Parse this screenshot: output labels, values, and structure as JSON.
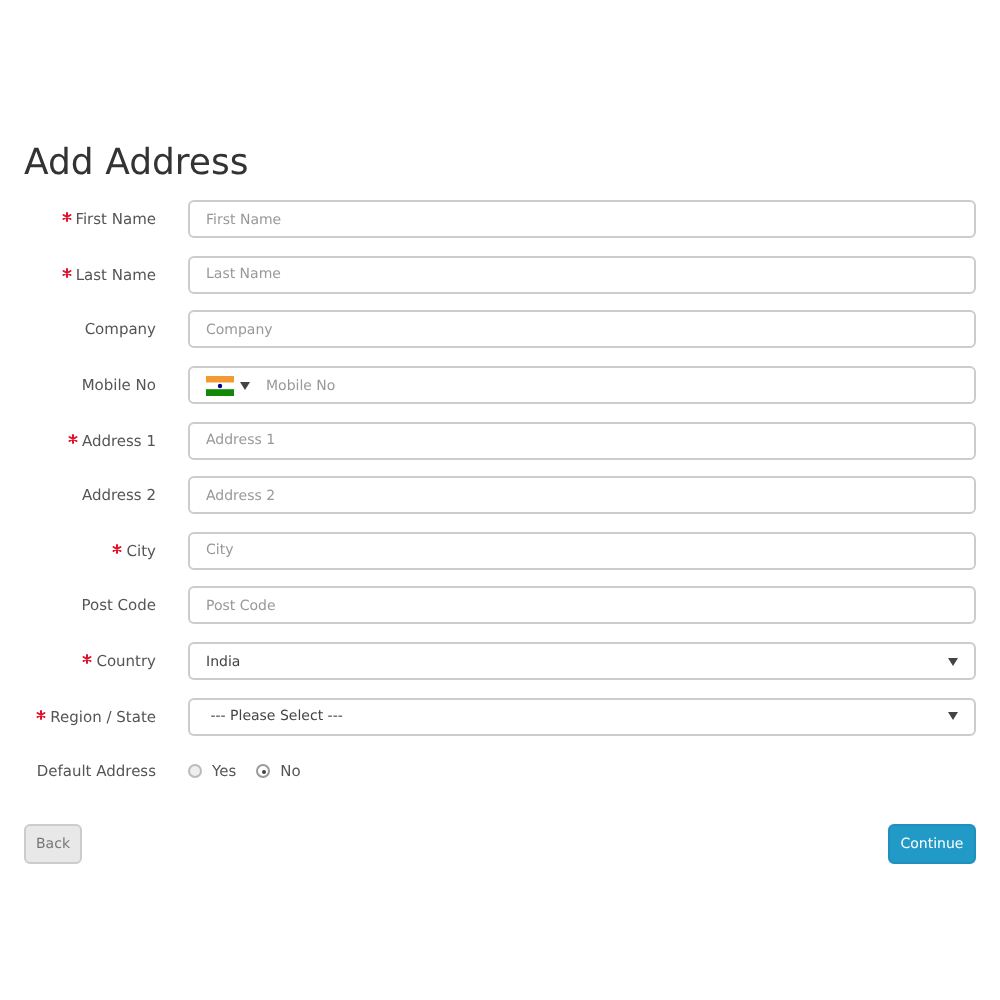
{
  "title": "Add Address",
  "fields": [
    {
      "kind": "text",
      "label": "First Name",
      "required": true,
      "placeholder": "First Name"
    },
    {
      "kind": "text",
      "label": "Last Name",
      "required": true,
      "placeholder": "Last Name"
    },
    {
      "kind": "text",
      "label": "Company",
      "required": false,
      "placeholder": "Company"
    },
    {
      "kind": "phone",
      "label": "Mobile No",
      "required": false,
      "placeholder": "Mobile No"
    },
    {
      "kind": "text",
      "label": "Address 1",
      "required": true,
      "placeholder": "Address 1"
    },
    {
      "kind": "text",
      "label": "Address 2",
      "required": false,
      "placeholder": "Address 2"
    },
    {
      "kind": "text",
      "label": "City",
      "required": true,
      "placeholder": "City"
    },
    {
      "kind": "text",
      "label": "Post Code",
      "required": false,
      "placeholder": "Post Code"
    },
    {
      "kind": "select",
      "label": "Country",
      "required": true,
      "value": "India"
    },
    {
      "kind": "select",
      "label": "Region / State",
      "required": true,
      "value": " --- Please Select --- "
    }
  ],
  "default_address": {
    "label": "Default Address",
    "options": [
      {
        "label": "Yes",
        "selected": false
      },
      {
        "label": "No",
        "selected": true
      }
    ]
  },
  "buttons": {
    "back": "Back",
    "continue": "Continue"
  }
}
